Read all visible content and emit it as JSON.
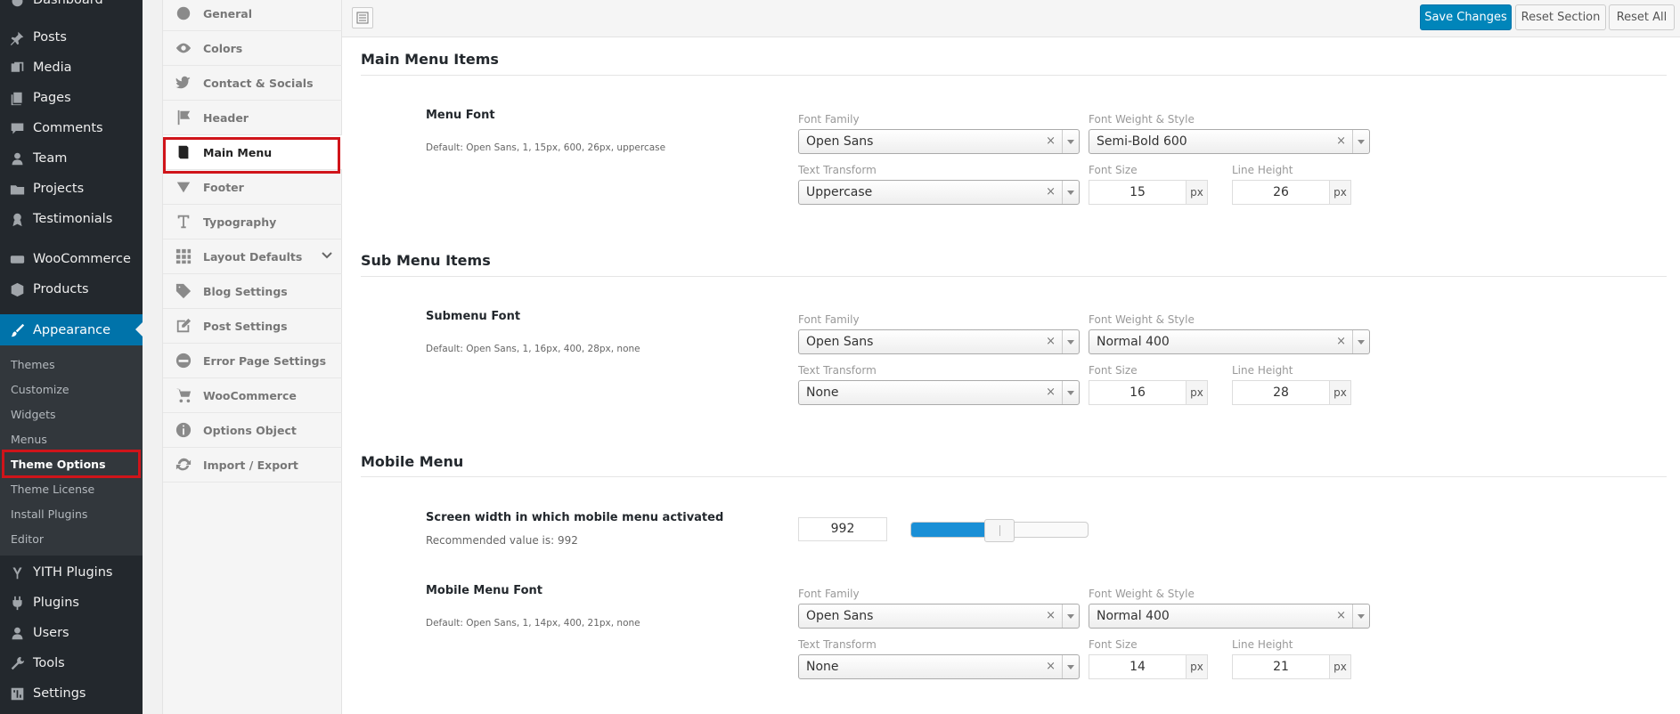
{
  "wp_menu": {
    "items": [
      {
        "label": "Dashboard",
        "icon": "gauge-icon"
      },
      {
        "label": "Posts",
        "icon": "pin-icon"
      },
      {
        "label": "Media",
        "icon": "media-icon"
      },
      {
        "label": "Pages",
        "icon": "pages-icon"
      },
      {
        "label": "Comments",
        "icon": "comment-icon"
      },
      {
        "label": "Team",
        "icon": "person-icon"
      },
      {
        "label": "Projects",
        "icon": "folder-icon"
      },
      {
        "label": "Testimonials",
        "icon": "award-icon"
      },
      {
        "label": "WooCommerce",
        "icon": "woo-icon"
      },
      {
        "label": "Products",
        "icon": "box-icon"
      },
      {
        "label": "Appearance",
        "icon": "brush-icon"
      },
      {
        "label": "YITH Plugins",
        "icon": "yith-icon"
      },
      {
        "label": "Plugins",
        "icon": "plug-icon"
      },
      {
        "label": "Users",
        "icon": "users-icon"
      },
      {
        "label": "Tools",
        "icon": "wrench-icon"
      },
      {
        "label": "Settings",
        "icon": "settings-icon"
      }
    ],
    "submenu": [
      "Themes",
      "Customize",
      "Widgets",
      "Menus",
      "Theme Options",
      "Theme License",
      "Install Plugins",
      "Editor"
    ]
  },
  "options_nav": [
    {
      "label": "General",
      "icon": "globe-icon"
    },
    {
      "label": "Colors",
      "icon": "eye-icon"
    },
    {
      "label": "Contact & Socials",
      "icon": "twitter-icon"
    },
    {
      "label": "Header",
      "icon": "flag-icon"
    },
    {
      "label": "Main Menu",
      "icon": "book-icon"
    },
    {
      "label": "Footer",
      "icon": "triangle-down-icon"
    },
    {
      "label": "Typography",
      "icon": "text-icon"
    },
    {
      "label": "Layout Defaults",
      "icon": "grid-icon"
    },
    {
      "label": "Blog Settings",
      "icon": "tag-icon"
    },
    {
      "label": "Post Settings",
      "icon": "edit-icon"
    },
    {
      "label": "Error Page Settings",
      "icon": "minus-circle-icon"
    },
    {
      "label": "WooCommerce",
      "icon": "cart-icon"
    },
    {
      "label": "Options Object",
      "icon": "info-icon"
    },
    {
      "label": "Import / Export",
      "icon": "refresh-icon"
    }
  ],
  "toolbar": {
    "save": "Save Changes",
    "reset_section": "Reset Section",
    "reset_all": "Reset All"
  },
  "labels": {
    "font_family": "Font Family",
    "font_weight": "Font Weight & Style",
    "text_transform": "Text Transform",
    "font_size": "Font Size",
    "line_height": "Line Height",
    "unit": "px",
    "clear": "×"
  },
  "sections": {
    "main": {
      "title": "Main Menu Items",
      "field_title": "Menu Font",
      "desc": "Default: Open Sans, 1, 15px, 600, 26px, uppercase",
      "family": "Open Sans",
      "weight": "Semi-Bold 600",
      "transform": "Uppercase",
      "size": "15",
      "line": "26"
    },
    "sub": {
      "title": "Sub Menu Items",
      "field_title": "Submenu Font",
      "desc": "Default: Open Sans, 1, 16px, 400, 28px, none",
      "family": "Open Sans",
      "weight": "Normal 400",
      "transform": "None",
      "size": "16",
      "line": "28"
    },
    "mobile": {
      "title": "Mobile Menu",
      "width_title": "Screen width in which mobile menu activated",
      "width_desc": "Recommended value is: 992",
      "width_value": "992",
      "slider_fraction": 0.5,
      "field_title": "Mobile Menu Font",
      "desc": "Default: Open Sans, 1, 14px, 400, 21px, none",
      "family": "Open Sans",
      "weight": "Normal 400",
      "transform": "None",
      "size": "14",
      "line": "21"
    }
  },
  "colors": {
    "accent": "#0073aa",
    "highlight": "#d0141a"
  }
}
